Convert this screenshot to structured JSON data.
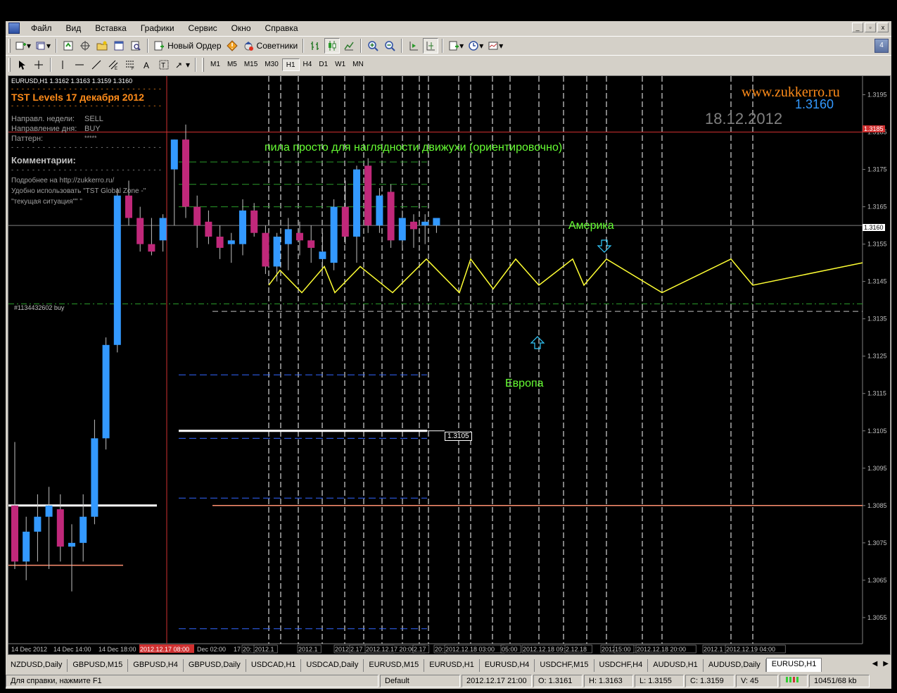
{
  "menu": [
    "Файл",
    "Вид",
    "Вставка",
    "Графики",
    "Сервис",
    "Окно",
    "Справка"
  ],
  "window_buttons": [
    "_",
    "▫",
    "x"
  ],
  "toolbar1": {
    "new_order_label": "Новый Ордер",
    "advisors_label": "Советники",
    "notify_count": "4"
  },
  "timeframes": [
    "M1",
    "M5",
    "M15",
    "M30",
    "H1",
    "H4",
    "D1",
    "W1",
    "MN"
  ],
  "active_timeframe": "H1",
  "chart": {
    "symbol_header": "EURUSD,H1  1.3162 1.3163 1.3159 1.3160",
    "tst_title": "TST Levels   17 декабря 2012",
    "week_direction_label": "Направл. недели:",
    "week_direction_value": "SELL",
    "day_direction_label": "Направление дня:",
    "day_direction_value": "BUY",
    "pattern_label": "Паттерн:",
    "pattern_value": "*****",
    "comments_label": "Комментарии:",
    "comment_line1": "Подробнее на http://zukkerro.ru/",
    "comment_line1b": "Удобно использовать \"TST Global Zone -\"",
    "comment_line2": "\"текущая ситуация\"\" \"",
    "site": "www.zukkerro.ru",
    "site_price": "1.3160",
    "date_stamp": "18.12.2012",
    "saw_caption": "пила просто для наглядности движухи (ориентировочно)",
    "america_label": "Америка",
    "europe_label": "Европа",
    "order_label": "#1134432602 buy",
    "price_tag": "1.3105",
    "red_price_tag": "1.3185",
    "current_price_tag": "1.3160"
  },
  "chart_data": {
    "type": "candlestick",
    "symbol": "EURUSD",
    "timeframe": "H1",
    "ylim": [
      1.3048,
      1.32
    ],
    "y_ticks": [
      "1.3195",
      "1.3185",
      "1.3175",
      "1.3165",
      "1.3155",
      "1.3145",
      "1.3135",
      "1.3125",
      "1.3115",
      "1.3105",
      "1.3095",
      "1.3085",
      "1.3075",
      "1.3065",
      "1.3055"
    ],
    "x_labels": [
      "14 Dec 2012",
      "14 Dec 14:00",
      "14 Dec 18:00",
      "2012.12.17 08:00",
      "Dec 02:00",
      "17",
      "20:",
      "2012.1",
      "2012.1",
      "2012.12.17 14:00",
      "2.17",
      "2012.12.17 20:00",
      "2.17",
      "20:",
      "2012.12.18 03:00",
      "05:00",
      "2012.12.18 09:00",
      "2.12.18",
      "2012.12.18 13:00",
      "15:00",
      "2012.12.18 20:00",
      "2012.1",
      "2012.12.19 04:00"
    ],
    "candles": [
      {
        "o": 1.3085,
        "h": 1.3102,
        "l": 1.3068,
        "c": 1.307
      },
      {
        "o": 1.307,
        "h": 1.3082,
        "l": 1.3065,
        "c": 1.3078
      },
      {
        "o": 1.3078,
        "h": 1.3088,
        "l": 1.307,
        "c": 1.3082
      },
      {
        "o": 1.3082,
        "h": 1.309,
        "l": 1.3068,
        "c": 1.3085
      },
      {
        "o": 1.3084,
        "h": 1.3088,
        "l": 1.307,
        "c": 1.3074
      },
      {
        "o": 1.3074,
        "h": 1.308,
        "l": 1.3062,
        "c": 1.3075
      },
      {
        "o": 1.3075,
        "h": 1.3088,
        "l": 1.307,
        "c": 1.3082
      },
      {
        "o": 1.3082,
        "h": 1.3108,
        "l": 1.308,
        "c": 1.3103
      },
      {
        "o": 1.3103,
        "h": 1.313,
        "l": 1.31,
        "c": 1.3128
      },
      {
        "o": 1.3128,
        "h": 1.317,
        "l": 1.3126,
        "c": 1.3168
      },
      {
        "o": 1.3168,
        "h": 1.3172,
        "l": 1.316,
        "c": 1.3162
      },
      {
        "o": 1.3162,
        "h": 1.3165,
        "l": 1.3153,
        "c": 1.3155
      },
      {
        "o": 1.3155,
        "h": 1.3162,
        "l": 1.3152,
        "c": 1.3153
      },
      {
        "o": 1.3156,
        "h": 1.3163,
        "l": 1.3153,
        "c": 1.3162
      },
      {
        "o": 1.3175,
        "h": 1.3183,
        "l": 1.316,
        "c": 1.3183
      },
      {
        "o": 1.3183,
        "h": 1.3187,
        "l": 1.3162,
        "c": 1.3165
      },
      {
        "o": 1.3165,
        "h": 1.3168,
        "l": 1.3154,
        "c": 1.316
      },
      {
        "o": 1.3161,
        "h": 1.3164,
        "l": 1.3155,
        "c": 1.3157
      },
      {
        "o": 1.3157,
        "h": 1.316,
        "l": 1.3151,
        "c": 1.3154
      },
      {
        "o": 1.3155,
        "h": 1.3158,
        "l": 1.315,
        "c": 1.3156
      },
      {
        "o": 1.3155,
        "h": 1.3167,
        "l": 1.3152,
        "c": 1.3164
      },
      {
        "o": 1.3164,
        "h": 1.3166,
        "l": 1.3157,
        "c": 1.3158
      },
      {
        "o": 1.3158,
        "h": 1.316,
        "l": 1.3147,
        "c": 1.3149
      },
      {
        "o": 1.3149,
        "h": 1.3158,
        "l": 1.3145,
        "c": 1.3157
      },
      {
        "o": 1.3155,
        "h": 1.3162,
        "l": 1.3148,
        "c": 1.3159
      },
      {
        "o": 1.3158,
        "h": 1.3161,
        "l": 1.3152,
        "c": 1.3156
      },
      {
        "o": 1.3156,
        "h": 1.316,
        "l": 1.315,
        "c": 1.3154
      },
      {
        "o": 1.3151,
        "h": 1.3158,
        "l": 1.3148,
        "c": 1.3153
      },
      {
        "o": 1.315,
        "h": 1.3167,
        "l": 1.3148,
        "c": 1.3165
      },
      {
        "o": 1.3165,
        "h": 1.3172,
        "l": 1.3155,
        "c": 1.3157
      },
      {
        "o": 1.3157,
        "h": 1.3176,
        "l": 1.315,
        "c": 1.3175
      },
      {
        "o": 1.3176,
        "h": 1.3178,
        "l": 1.3158,
        "c": 1.316
      },
      {
        "o": 1.316,
        "h": 1.317,
        "l": 1.3158,
        "c": 1.3168
      },
      {
        "o": 1.3169,
        "h": 1.3171,
        "l": 1.3154,
        "c": 1.3156
      },
      {
        "o": 1.3156,
        "h": 1.3164,
        "l": 1.3154,
        "c": 1.3162
      },
      {
        "o": 1.3161,
        "h": 1.3163,
        "l": 1.3154,
        "c": 1.3159
      },
      {
        "o": 1.316,
        "h": 1.3163,
        "l": 1.3155,
        "c": 1.3161
      },
      {
        "o": 1.316,
        "h": 1.3162,
        "l": 1.3158,
        "c": 1.3162
      }
    ]
  },
  "tabs": [
    "NZDUSD,Daily",
    "GBPUSD,M15",
    "GBPUSD,H4",
    "GBPUSD,Daily",
    "USDCAD,H1",
    "USDCAD,Daily",
    "EURUSD,M15",
    "EURUSD,H1",
    "EURUSD,H4",
    "USDCHF,M15",
    "USDCHF,H4",
    "AUDUSD,H1",
    "AUDUSD,Daily",
    "EURUSD,H1"
  ],
  "active_tab_index": 13,
  "status": {
    "help": "Для справки, нажмите F1",
    "profile": "Default",
    "datetime": "2012.12.17 21:00",
    "open": "O: 1.3161",
    "high": "H: 1.3163",
    "low": "L: 1.3155",
    "close": "C: 1.3159",
    "volume": "V: 45",
    "traffic": "10451/68 kb"
  },
  "colors": {
    "bull": "#3399ff",
    "bear": "#c0287a",
    "saw": "#ffff33",
    "green_text": "#66ff33",
    "orange": "#ff8c1a",
    "grid_red": "#d03030"
  }
}
